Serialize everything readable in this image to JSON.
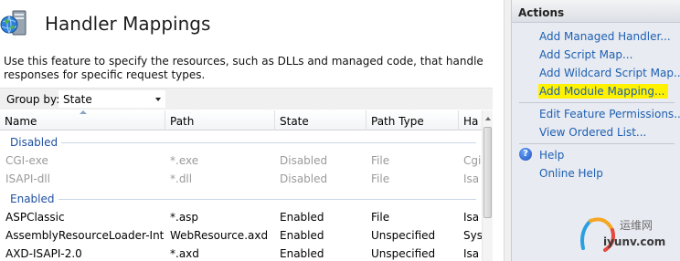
{
  "page": {
    "title": "Handler Mappings",
    "description": "Use this feature to specify the resources, such as DLLs and managed code, that handle responses for specific request types."
  },
  "groupby": {
    "label": "Group by:",
    "selected": "State"
  },
  "grid": {
    "columns": [
      "Name",
      "Path",
      "State",
      "Path Type",
      "Ha"
    ],
    "groups": [
      {
        "label": "Disabled",
        "rows": [
          {
            "name": "CGI-exe",
            "path": "*.exe",
            "state": "Disabled",
            "path_type": "File",
            "handler": "Cgi"
          },
          {
            "name": "ISAPI-dll",
            "path": "*.dll",
            "state": "Disabled",
            "path_type": "File",
            "handler": "Isa"
          }
        ]
      },
      {
        "label": "Enabled",
        "rows": [
          {
            "name": "ASPClassic",
            "path": "*.asp",
            "state": "Enabled",
            "path_type": "File",
            "handler": "Isa"
          },
          {
            "name": "AssemblyResourceLoader-Inte...",
            "path": "WebResource.axd",
            "state": "Enabled",
            "path_type": "Unspecified",
            "handler": "Sys"
          },
          {
            "name": "AXD-ISAPI-2.0",
            "path": "*.axd",
            "state": "Enabled",
            "path_type": "Unspecified",
            "handler": "Isa"
          }
        ]
      }
    ]
  },
  "actions": {
    "header": "Actions",
    "items": [
      "Add Managed Handler...",
      "Add Script Map...",
      "Add Wildcard Script Map...",
      "Add Module Mapping...",
      "Edit Feature Permissions...",
      "View Ordered List...",
      "Help",
      "Online Help"
    ],
    "highlight_color": "#fff200"
  },
  "watermark": {
    "line1": "运维网",
    "line2": "iyunv.com"
  },
  "colors": {
    "link": "#1d5fb3",
    "group_label": "#1f4f9e",
    "disabled_text": "#9a9a9a"
  }
}
